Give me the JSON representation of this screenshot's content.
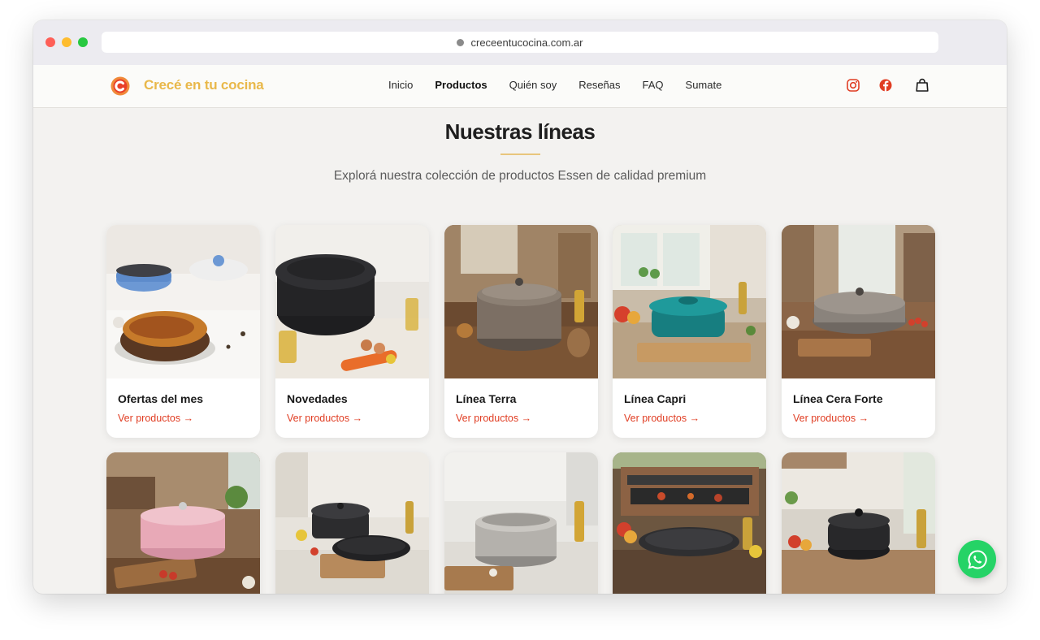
{
  "browser": {
    "url": "creceentucocina.com.ar"
  },
  "header": {
    "brand": "Crecé en tu cocina",
    "nav": [
      "Inicio",
      "Productos",
      "Quién soy",
      "Reseñas",
      "FAQ",
      "Sumate"
    ],
    "active_nav": "Productos",
    "icons": [
      "instagram-icon",
      "facebook-icon",
      "shopping-bag-icon"
    ]
  },
  "section": {
    "title": "Nuestras líneas",
    "subtitle": "Explorá nuestra colección de productos Essen de calidad premium"
  },
  "cards": [
    {
      "name": "Ofertas del mes",
      "link": "Ver productos →"
    },
    {
      "name": "Novedades",
      "link": "Ver productos →"
    },
    {
      "name": "Línea Terra",
      "link": "Ver productos →"
    },
    {
      "name": "Línea Capri",
      "link": "Ver productos →"
    },
    {
      "name": "Línea Cera Forte",
      "link": "Ver productos →"
    }
  ],
  "colors": {
    "brand": "#e9b84a",
    "accent": "#e03d23",
    "whatsapp": "#25d366"
  }
}
